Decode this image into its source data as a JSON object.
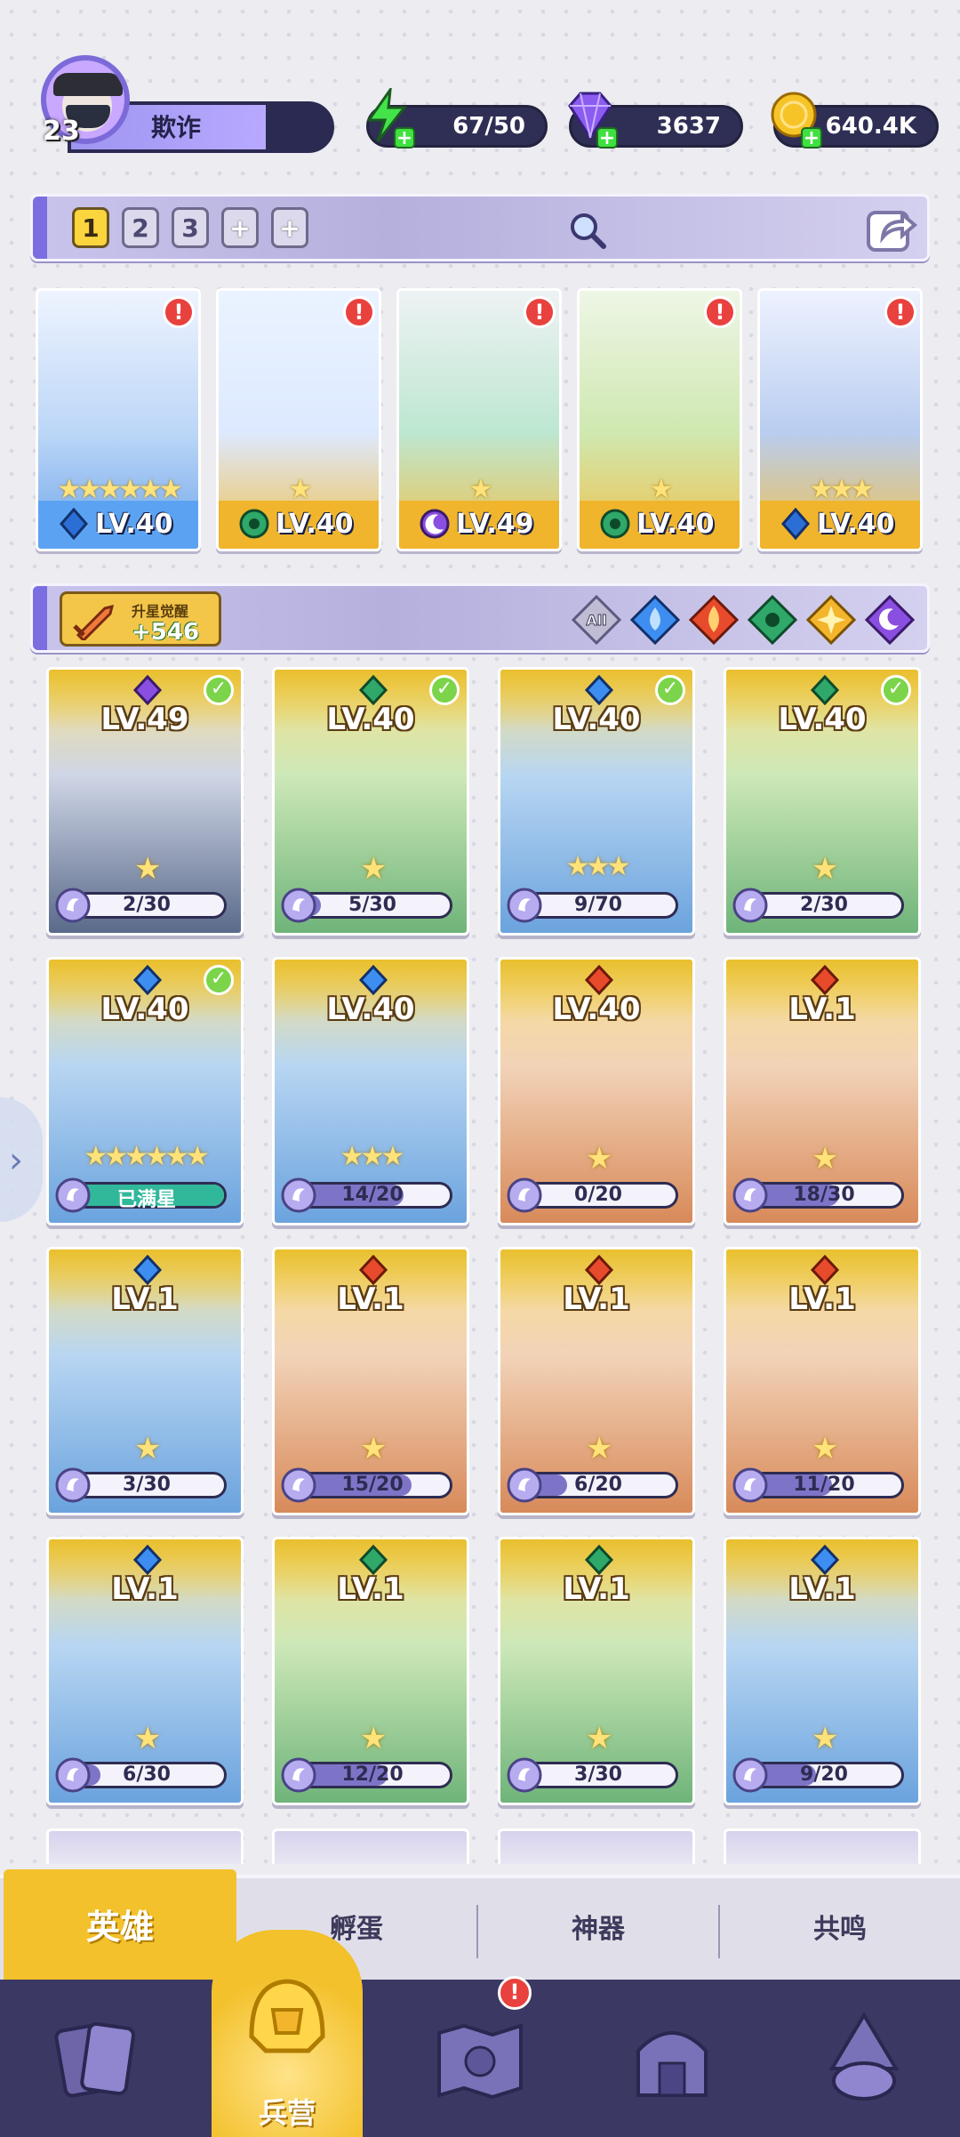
{
  "player": {
    "level": "23",
    "name": "欺诈"
  },
  "resources": [
    {
      "id": "energy",
      "value": "67/50",
      "icon": "lightning-icon",
      "color": "#43e34a"
    },
    {
      "id": "gems",
      "value": "3637",
      "icon": "diamond-icon",
      "color": "#8c5cf0"
    },
    {
      "id": "gold",
      "value": "640.4K",
      "icon": "coin-icon",
      "color": "#f1b41e"
    }
  ],
  "team_slots": {
    "slot1": "1",
    "slot2": "2",
    "slot3": "3",
    "add1": "+",
    "add2": "+"
  },
  "team": [
    {
      "level": "LV.40",
      "stars": "★★★★★★",
      "element": "water",
      "alert": "!"
    },
    {
      "level": "LV.40",
      "stars": "★",
      "element": "nature",
      "alert": "!"
    },
    {
      "level": "LV.49",
      "stars": "★",
      "element": "dark",
      "alert": "!"
    },
    {
      "level": "LV.40",
      "stars": "★",
      "element": "nature",
      "alert": "!"
    },
    {
      "level": "LV.40",
      "stars": "★★★",
      "element": "water",
      "alert": "!"
    }
  ],
  "awaken": {
    "title": "升星觉醒",
    "value": "+546"
  },
  "filters": {
    "all": "All",
    "items": [
      "water",
      "fire",
      "nature",
      "light",
      "dark"
    ]
  },
  "heroes": [
    {
      "level": "LV.49",
      "element": "dark",
      "progress": "2/30",
      "ratio": 0.067,
      "stars": 1,
      "check": true
    },
    {
      "level": "LV.40",
      "element": "nature",
      "progress": "5/30",
      "ratio": 0.167,
      "stars": 1,
      "check": true
    },
    {
      "level": "LV.40",
      "element": "water",
      "progress": "9/70",
      "ratio": 0.129,
      "stars": 3,
      "check": true
    },
    {
      "level": "LV.40",
      "element": "nature",
      "progress": "2/30",
      "ratio": 0.067,
      "stars": 1,
      "check": true
    },
    {
      "level": "LV.40",
      "element": "water",
      "progress": "已满星",
      "ratio": 1,
      "stars": 6,
      "check": true
    },
    {
      "level": "LV.40",
      "element": "water",
      "progress": "14/20",
      "ratio": 0.7,
      "stars": 3,
      "check": false
    },
    {
      "level": "LV.40",
      "element": "fire",
      "progress": "0/20",
      "ratio": 0,
      "stars": 1,
      "check": false
    },
    {
      "level": "LV.1",
      "element": "fire",
      "progress": "18/30",
      "ratio": 0.6,
      "stars": 1,
      "check": false
    },
    {
      "level": "LV.1",
      "element": "water",
      "progress": "3/30",
      "ratio": 0.1,
      "stars": 1,
      "check": false
    },
    {
      "level": "LV.1",
      "element": "fire",
      "progress": "15/20",
      "ratio": 0.75,
      "stars": 1,
      "check": false
    },
    {
      "level": "LV.1",
      "element": "fire",
      "progress": "6/20",
      "ratio": 0.3,
      "stars": 1,
      "check": false
    },
    {
      "level": "LV.1",
      "element": "fire",
      "progress": "11/20",
      "ratio": 0.55,
      "stars": 1,
      "check": false
    },
    {
      "level": "LV.1",
      "element": "water",
      "progress": "6/30",
      "ratio": 0.2,
      "stars": 1,
      "check": false
    },
    {
      "level": "LV.1",
      "element": "nature",
      "progress": "12/20",
      "ratio": 0.6,
      "stars": 1,
      "check": false
    },
    {
      "level": "LV.1",
      "element": "nature",
      "progress": "3/30",
      "ratio": 0.1,
      "stars": 1,
      "check": false
    },
    {
      "level": "LV.1",
      "element": "water",
      "progress": "9/20",
      "ratio": 0.45,
      "stars": 1,
      "check": false
    }
  ],
  "subtabs": {
    "heroes": "英雄",
    "hatch": "孵蛋",
    "artifact": "神器",
    "resonance": "共鸣"
  },
  "nav": {
    "barracks": "兵营",
    "alert": "!"
  },
  "colors": {
    "water": "#3d8ef0",
    "fire": "#e84a2c",
    "nature": "#2fa86a",
    "dark": "#8a4ee0",
    "light": "#f3b52c"
  }
}
